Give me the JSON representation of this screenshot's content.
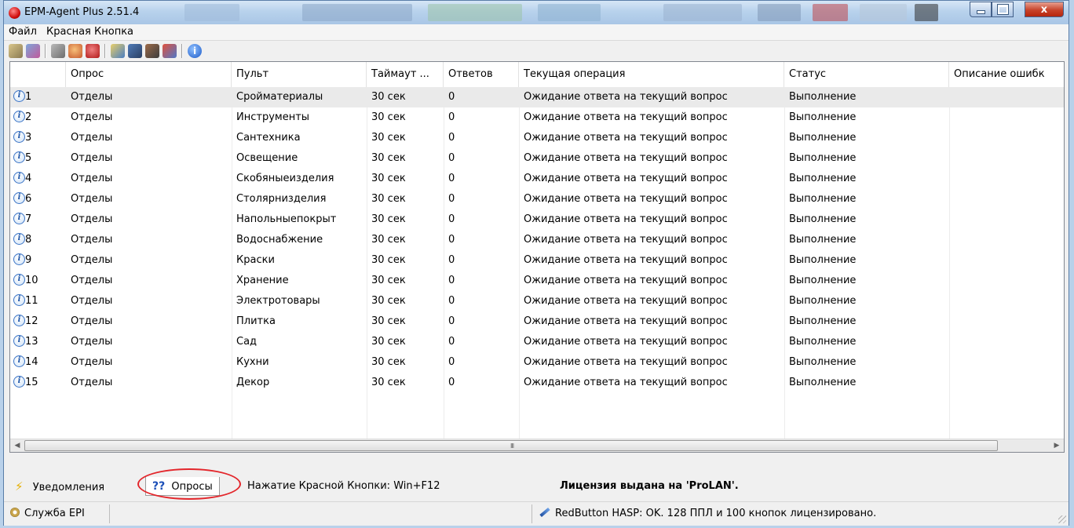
{
  "window": {
    "title": "EPM-Agent Plus 2.51.4",
    "minimize_icon": "minimize-icon",
    "maximize_icon": "maximize-icon",
    "close_label": "x"
  },
  "menu": {
    "file": "Файл",
    "red_button": "Красная Кнопка"
  },
  "toolbar": {
    "icons": [
      "settings-icon",
      "connect-icon",
      "stop-icon",
      "users-icon",
      "alert-icon",
      "report-icon",
      "film-icon",
      "mail-icon",
      "tools-icon",
      "info-icon"
    ]
  },
  "grid": {
    "columns": [
      {
        "label": ""
      },
      {
        "label": "Опрос"
      },
      {
        "label": "Пульт"
      },
      {
        "label": "Таймаут ..."
      },
      {
        "label": "Ответов"
      },
      {
        "label": "Текущая операция"
      },
      {
        "label": "Статус"
      },
      {
        "label": "Описание ошибк"
      }
    ],
    "rows": [
      {
        "num": "1",
        "poll": "Отделы",
        "remote": "Сройматериалы",
        "timeout": "30 сек",
        "answers": "0",
        "op": "Ожидание ответа на текущий вопрос",
        "status": "Выполнение",
        "err": ""
      },
      {
        "num": "2",
        "poll": "Отделы",
        "remote": "Инструменты",
        "timeout": "30 сек",
        "answers": "0",
        "op": "Ожидание ответа на текущий вопрос",
        "status": "Выполнение",
        "err": ""
      },
      {
        "num": "3",
        "poll": "Отделы",
        "remote": "Сантехника",
        "timeout": "30 сек",
        "answers": "0",
        "op": "Ожидание ответа на текущий вопрос",
        "status": "Выполнение",
        "err": ""
      },
      {
        "num": "5",
        "poll": "Отделы",
        "remote": "Освещение",
        "timeout": "30 сек",
        "answers": "0",
        "op": "Ожидание ответа на текущий вопрос",
        "status": "Выполнение",
        "err": ""
      },
      {
        "num": "4",
        "poll": "Отделы",
        "remote": "Скобяныеизделия",
        "timeout": "30 сек",
        "answers": "0",
        "op": "Ожидание ответа на текущий вопрос",
        "status": "Выполнение",
        "err": ""
      },
      {
        "num": "6",
        "poll": "Отделы",
        "remote": "Столярнизделия",
        "timeout": "30 сек",
        "answers": "0",
        "op": "Ожидание ответа на текущий вопрос",
        "status": "Выполнение",
        "err": ""
      },
      {
        "num": "7",
        "poll": "Отделы",
        "remote": "Напольныепокрыт",
        "timeout": "30 сек",
        "answers": "0",
        "op": "Ожидание ответа на текущий вопрос",
        "status": "Выполнение",
        "err": ""
      },
      {
        "num": "8",
        "poll": "Отделы",
        "remote": "Водоснабжение",
        "timeout": "30 сек",
        "answers": "0",
        "op": "Ожидание ответа на текущий вопрос",
        "status": "Выполнение",
        "err": ""
      },
      {
        "num": "9",
        "poll": "Отделы",
        "remote": "Краски",
        "timeout": "30 сек",
        "answers": "0",
        "op": "Ожидание ответа на текущий вопрос",
        "status": "Выполнение",
        "err": ""
      },
      {
        "num": "10",
        "poll": "Отделы",
        "remote": "Хранение",
        "timeout": "30 сек",
        "answers": "0",
        "op": "Ожидание ответа на текущий вопрос",
        "status": "Выполнение",
        "err": ""
      },
      {
        "num": "11",
        "poll": "Отделы",
        "remote": "Электротовары",
        "timeout": "30 сек",
        "answers": "0",
        "op": "Ожидание ответа на текущий вопрос",
        "status": "Выполнение",
        "err": ""
      },
      {
        "num": "12",
        "poll": "Отделы",
        "remote": "Плитка",
        "timeout": "30 сек",
        "answers": "0",
        "op": "Ожидание ответа на текущий вопрос",
        "status": "Выполнение",
        "err": ""
      },
      {
        "num": "13",
        "poll": "Отделы",
        "remote": "Сад",
        "timeout": "30 сек",
        "answers": "0",
        "op": "Ожидание ответа на текущий вопрос",
        "status": "Выполнение",
        "err": ""
      },
      {
        "num": "14",
        "poll": "Отделы",
        "remote": "Кухни",
        "timeout": "30 сек",
        "answers": "0",
        "op": "Ожидание ответа на текущий вопрос",
        "status": "Выполнение",
        "err": ""
      },
      {
        "num": "15",
        "poll": "Отделы",
        "remote": "Декор",
        "timeout": "30 сек",
        "answers": "0",
        "op": "Ожидание ответа на текущий вопрос",
        "status": "Выполнение",
        "err": ""
      }
    ],
    "row_icon": "question-info-icon",
    "scroll_grip": "III"
  },
  "tabs": {
    "notifications": "Уведомления",
    "polls_glyph": "??",
    "polls": "Опросы",
    "hotkey": "Нажатие Красной Кнопки: Win+F12",
    "license": "Лицензия выдана на 'ProLAN'."
  },
  "status": {
    "service": "Служба EPI",
    "hasp": "RedButton HASP: OK. 128 ППЛ и 100 кнопок лицензировано."
  },
  "colors": {
    "highlight_ellipse": "#e3262b",
    "selected_row": "#eaeaea"
  }
}
